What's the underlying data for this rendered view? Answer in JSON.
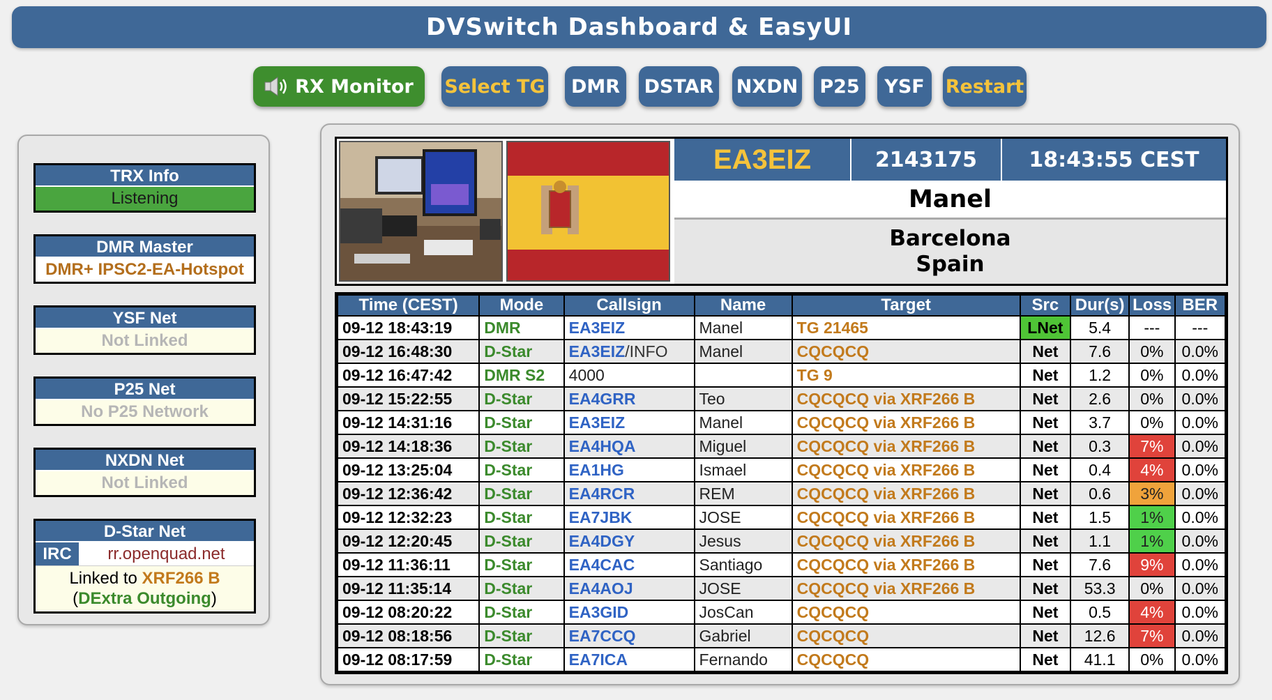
{
  "header": {
    "title": "DVSwitch Dashboard & EasyUI"
  },
  "toolbar": {
    "rx_monitor": "RX Monitor",
    "select_tg": "Select TG",
    "dmr": "DMR",
    "dstar": "DSTAR",
    "nxdn": "NXDN",
    "p25": "P25",
    "ysf": "YSF",
    "restart": "Restart"
  },
  "colors": {
    "accent": "#3f6897",
    "green": "#3e8e2e",
    "yellow": "#f5c33b"
  },
  "sidebar": {
    "trx": {
      "title": "TRX Info",
      "value": "Listening"
    },
    "dmr_master": {
      "title": "DMR Master",
      "value": "DMR+ IPSC2-EA-Hotspot"
    },
    "ysf": {
      "title": "YSF Net",
      "value": "Not Linked"
    },
    "p25": {
      "title": "P25 Net",
      "value": "No P25 Network"
    },
    "nxdn": {
      "title": "NXDN Net",
      "value": "Not Linked"
    },
    "dstar": {
      "title": "D-Star Net",
      "irc_label": "IRC",
      "irc_value": "rr.openquad.net",
      "linked_prefix": "Linked to",
      "linked_ref": "XRF266 B",
      "linked_mode_open": "(",
      "linked_mode": "DExtra Outgoing",
      "linked_mode_close": ")"
    }
  },
  "hero": {
    "callsign": "EA3EIZ",
    "dmr_id": "2143175",
    "time": "18:43:55 CEST",
    "name": "Manel",
    "city": "Barcelona",
    "country": "Spain"
  },
  "table": {
    "headers": [
      "Time (CEST)",
      "Mode",
      "Callsign",
      "Name",
      "Target",
      "Src",
      "Dur(s)",
      "Loss",
      "BER"
    ],
    "rows": [
      {
        "time": "09-12 18:43:19",
        "mode": "DMR",
        "callsign": "EA3EIZ",
        "suffix": "",
        "name": "Manel",
        "target": "TG 21465",
        "src": "LNet",
        "dur": "5.4",
        "loss": "---",
        "loss_level": "",
        "ber": "---"
      },
      {
        "time": "09-12 16:48:30",
        "mode": "D-Star",
        "callsign": "EA3EIZ",
        "suffix": "/INFO",
        "name": "Manel",
        "target": "CQCQCQ",
        "src": "Net",
        "dur": "7.6",
        "loss": "0%",
        "loss_level": "",
        "ber": "0.0%"
      },
      {
        "time": "09-12 16:47:42",
        "mode": "DMR S2",
        "callsign": "4000",
        "suffix": "",
        "name": "",
        "target": "TG 9",
        "src": "Net",
        "dur": "1.2",
        "loss": "0%",
        "loss_level": "",
        "ber": "0.0%",
        "plain": true
      },
      {
        "time": "09-12 15:22:55",
        "mode": "D-Star",
        "callsign": "EA4GRR",
        "suffix": "",
        "name": "Teo",
        "target": "CQCQCQ via XRF266 B",
        "src": "Net",
        "dur": "2.6",
        "loss": "0%",
        "loss_level": "",
        "ber": "0.0%"
      },
      {
        "time": "09-12 14:31:16",
        "mode": "D-Star",
        "callsign": "EA3EIZ",
        "suffix": "",
        "name": "Manel",
        "target": "CQCQCQ via XRF266 B",
        "src": "Net",
        "dur": "3.7",
        "loss": "0%",
        "loss_level": "",
        "ber": "0.0%"
      },
      {
        "time": "09-12 14:18:36",
        "mode": "D-Star",
        "callsign": "EA4HQA",
        "suffix": "",
        "name": "Miguel",
        "target": "CQCQCQ via XRF266 B",
        "src": "Net",
        "dur": "0.3",
        "loss": "7%",
        "loss_level": "red",
        "ber": "0.0%"
      },
      {
        "time": "09-12 13:25:04",
        "mode": "D-Star",
        "callsign": "EA1HG",
        "suffix": "",
        "name": "Ismael",
        "target": "CQCQCQ via XRF266 B",
        "src": "Net",
        "dur": "0.4",
        "loss": "4%",
        "loss_level": "red",
        "ber": "0.0%"
      },
      {
        "time": "09-12 12:36:42",
        "mode": "D-Star",
        "callsign": "EA4RCR",
        "suffix": "",
        "name": "REM",
        "target": "CQCQCQ via XRF266 B",
        "src": "Net",
        "dur": "0.6",
        "loss": "3%",
        "loss_level": "orange",
        "ber": "0.0%"
      },
      {
        "time": "09-12 12:32:23",
        "mode": "D-Star",
        "callsign": "EA7JBK",
        "suffix": "",
        "name": "JOSE",
        "target": "CQCQCQ via XRF266 B",
        "src": "Net",
        "dur": "1.5",
        "loss": "1%",
        "loss_level": "green",
        "ber": "0.0%"
      },
      {
        "time": "09-12 12:20:45",
        "mode": "D-Star",
        "callsign": "EA4DGY",
        "suffix": "",
        "name": "Jesus",
        "target": "CQCQCQ via XRF266 B",
        "src": "Net",
        "dur": "1.1",
        "loss": "1%",
        "loss_level": "green",
        "ber": "0.0%"
      },
      {
        "time": "09-12 11:36:11",
        "mode": "D-Star",
        "callsign": "EA4CAC",
        "suffix": "",
        "name": "Santiago",
        "target": "CQCQCQ via XRF266 B",
        "src": "Net",
        "dur": "7.6",
        "loss": "9%",
        "loss_level": "red",
        "ber": "0.0%"
      },
      {
        "time": "09-12 11:35:14",
        "mode": "D-Star",
        "callsign": "EA4AOJ",
        "suffix": "",
        "name": "JOSE",
        "target": "CQCQCQ via XRF266 B",
        "src": "Net",
        "dur": "53.3",
        "loss": "0%",
        "loss_level": "",
        "ber": "0.0%"
      },
      {
        "time": "09-12 08:20:22",
        "mode": "D-Star",
        "callsign": "EA3GID",
        "suffix": "",
        "name": "JosCan",
        "target": "CQCQCQ",
        "src": "Net",
        "dur": "0.5",
        "loss": "4%",
        "loss_level": "red",
        "ber": "0.0%"
      },
      {
        "time": "09-12 08:18:56",
        "mode": "D-Star",
        "callsign": "EA7CCQ",
        "suffix": "",
        "name": "Gabriel",
        "target": "CQCQCQ",
        "src": "Net",
        "dur": "12.6",
        "loss": "7%",
        "loss_level": "red",
        "ber": "0.0%"
      },
      {
        "time": "09-12 08:17:59",
        "mode": "D-Star",
        "callsign": "EA7ICA",
        "suffix": "",
        "name": "Fernando",
        "target": "CQCQCQ",
        "src": "Net",
        "dur": "41.1",
        "loss": "0%",
        "loss_level": "",
        "ber": "0.0%"
      }
    ]
  }
}
